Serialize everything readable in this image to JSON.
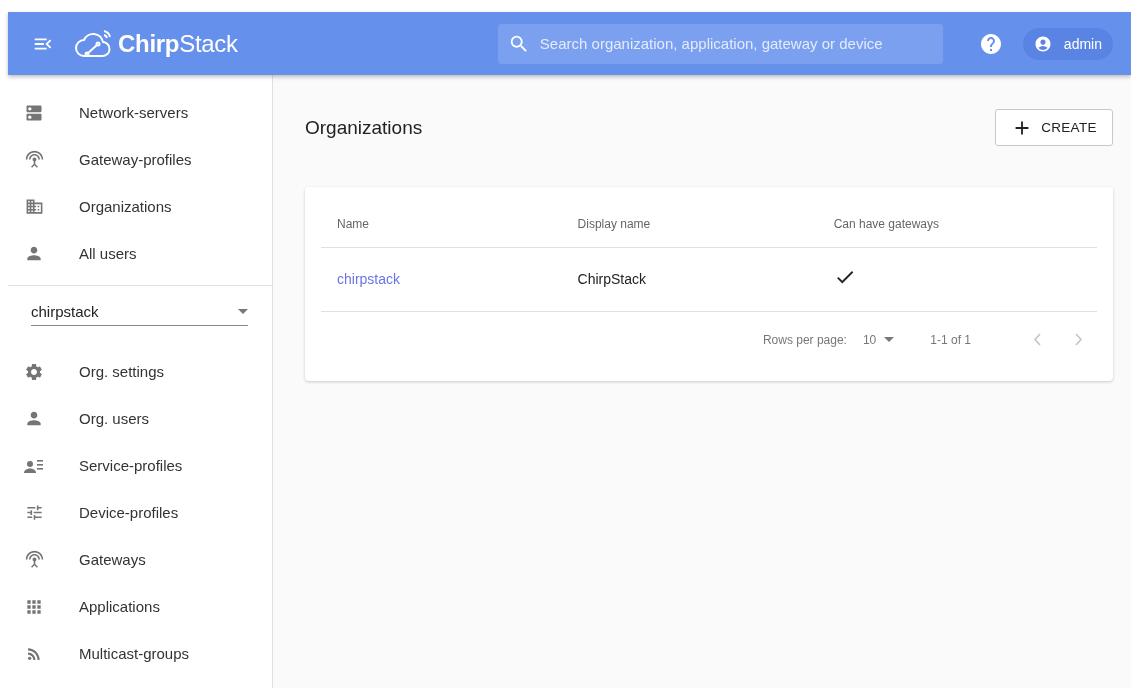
{
  "header": {
    "logo": "**Chirp**Stack",
    "search": {
      "placeholder": "Search organization, application, gateway or device"
    },
    "user": "admin"
  },
  "sidebar": {
    "admin_items": [
      {
        "label": "Network-servers",
        "kind": "servers",
        "selected": false
      },
      {
        "label": "Gateway-profiles",
        "kind": "antenna",
        "selected": false
      },
      {
        "label": "Organizations",
        "kind": "building",
        "selected": false
      },
      {
        "label": "All users",
        "kind": "person",
        "selected": false
      }
    ],
    "organization_select": {
      "value": "chirpstack"
    },
    "org_items": [
      {
        "label": "Org. settings",
        "kind": "gear",
        "selected": false
      },
      {
        "label": "Org. users",
        "kind": "person",
        "selected": false
      },
      {
        "label": "Service-profiles",
        "kind": "person-list",
        "selected": false
      },
      {
        "label": "Device-profiles",
        "kind": "sliders",
        "selected": false
      },
      {
        "label": "Gateways",
        "kind": "antenna",
        "selected": false
      },
      {
        "label": "Applications",
        "kind": "grid",
        "selected": false
      },
      {
        "label": "Multicast-groups",
        "kind": "feed",
        "selected": false
      }
    ]
  },
  "page": {
    "title": "Organizations",
    "create_button": "CREATE"
  },
  "table": {
    "columns": [
      "Name",
      "Display name",
      "Can have gateways"
    ],
    "rows": [
      {
        "name": "chirpstack",
        "display_name": "ChirpStack",
        "can_have_gateways": true
      }
    ],
    "pagination": {
      "rows_per_page_label": "Rows per page:",
      "rows_per_page": "10",
      "range": "1-1 of 1",
      "prev_disabled": true,
      "next_disabled": true
    }
  }
}
